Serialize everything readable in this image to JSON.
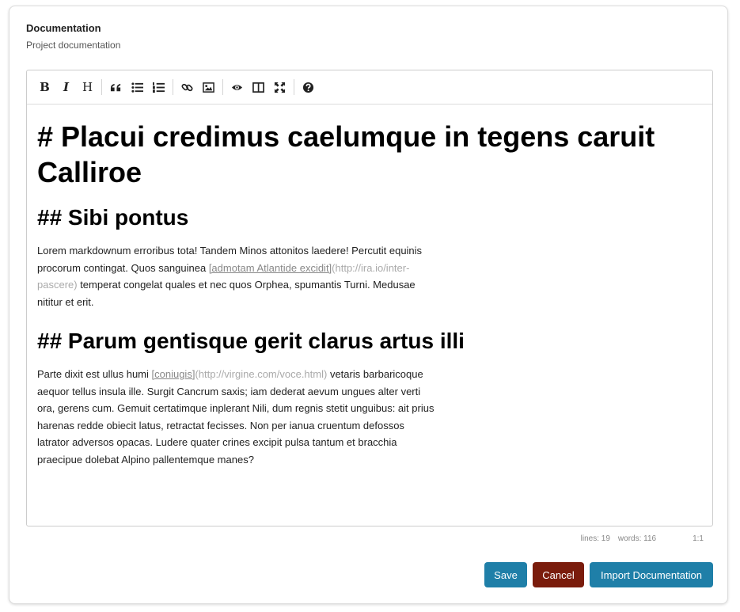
{
  "header": {
    "title": "Documentation",
    "subtitle": "Project documentation"
  },
  "toolbar": {
    "bold": "B",
    "italic": "I",
    "heading": "H",
    "icons": [
      "quote-icon",
      "unordered-list-icon",
      "ordered-list-icon",
      "link-icon",
      "image-icon",
      "preview-icon",
      "side-by-side-icon",
      "fullscreen-icon",
      "help-icon"
    ]
  },
  "editor": {
    "h1": "# Placui credimus caelumque in tegens caruit Calliroe",
    "h2_1": "## Sibi pontus",
    "p1_part1": "Lorem markdownum erroribus tota! Tandem Minos attonitos laedere! Percutit equinis procorum contingat. Quos sanguinea ",
    "p1_link": "[admotam Atlantide excidit]",
    "p1_url": "(http://ira.io/inter-pascere)",
    "p1_part2": " temperat congelat quales et nec quos Orphea, spumantis Turni. Medusae nititur et erit.",
    "h2_2": "## Parum gentisque gerit clarus artus illi",
    "p2_part1": "Parte dixit est ullus humi ",
    "p2_link": "[coniugis]",
    "p2_url": "(http://virgine.com/voce.html)",
    "p2_part2": " vetaris barbaricoque aequor tellus insula ille. Surgit Cancrum saxis; iam dederat aevum ungues alter verti ora, gerens cum. Gemuit certatimque inplerant Nili, dum regnis stetit unguibus: ait prius harenas redde obiecit latus, retractat fecisses. Non per ianua cruentum defossos latrator adversos opacas. Ludere quater crines excipit pulsa tantum et bracchia praecipue dolebat Alpino pallentemque manes?"
  },
  "status": {
    "lines": "lines: 19",
    "words": "words: 116",
    "cursor": "1:1"
  },
  "buttons": {
    "save": "Save",
    "cancel": "Cancel",
    "import": "Import Documentation"
  },
  "colors": {
    "primary": "#1f7fa8",
    "danger": "#7a1c0c"
  }
}
